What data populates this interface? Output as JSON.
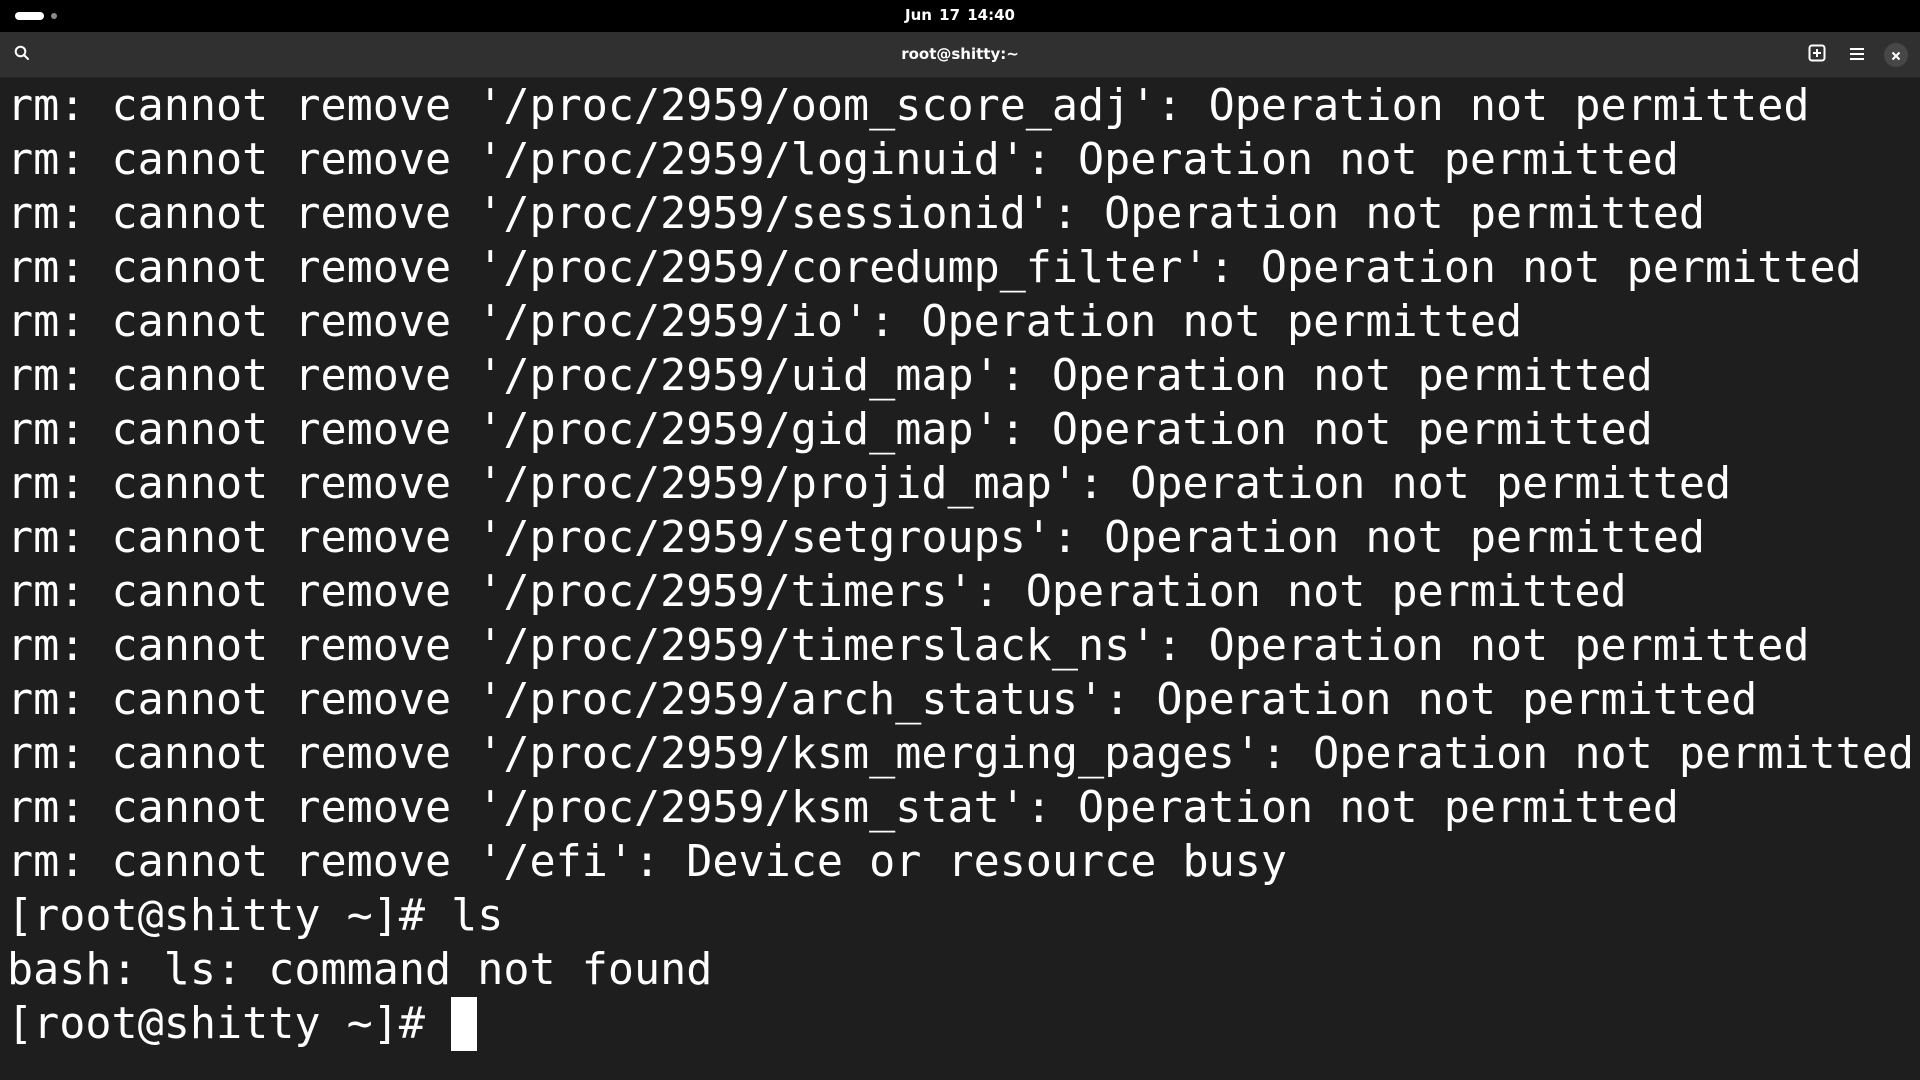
{
  "topbar": {
    "clock": "Jun 17  14:40",
    "workspaces": {
      "active": 1,
      "count": 2
    }
  },
  "headerbar": {
    "title": "root@shitty:~",
    "icons": {
      "search": "search-icon",
      "new_tab": "new-tab-icon",
      "menu": "hamburger-menu-icon",
      "close": "close-icon"
    }
  },
  "terminal": {
    "lines": [
      "rm: cannot remove '/proc/2959/oom_score_adj': Operation not permitted",
      "rm: cannot remove '/proc/2959/loginuid': Operation not permitted",
      "rm: cannot remove '/proc/2959/sessionid': Operation not permitted",
      "rm: cannot remove '/proc/2959/coredump_filter': Operation not permitted",
      "rm: cannot remove '/proc/2959/io': Operation not permitted",
      "rm: cannot remove '/proc/2959/uid_map': Operation not permitted",
      "rm: cannot remove '/proc/2959/gid_map': Operation not permitted",
      "rm: cannot remove '/proc/2959/projid_map': Operation not permitted",
      "rm: cannot remove '/proc/2959/setgroups': Operation not permitted",
      "rm: cannot remove '/proc/2959/timers': Operation not permitted",
      "rm: cannot remove '/proc/2959/timerslack_ns': Operation not permitted",
      "rm: cannot remove '/proc/2959/arch_status': Operation not permitted",
      "rm: cannot remove '/proc/2959/ksm_merging_pages': Operation not permitted",
      "rm: cannot remove '/proc/2959/ksm_stat': Operation not permitted",
      "rm: cannot remove '/efi': Device or resource busy",
      "[root@shitty ~]# ls",
      "bash: ls: command not found"
    ],
    "prompt": "[root@shitty ~]# ",
    "input": ""
  },
  "colors": {
    "terminal_bg": "#1e1e1e",
    "headerbar_bg": "#303030",
    "topbar_bg": "#000000",
    "text": "#ffffff"
  }
}
